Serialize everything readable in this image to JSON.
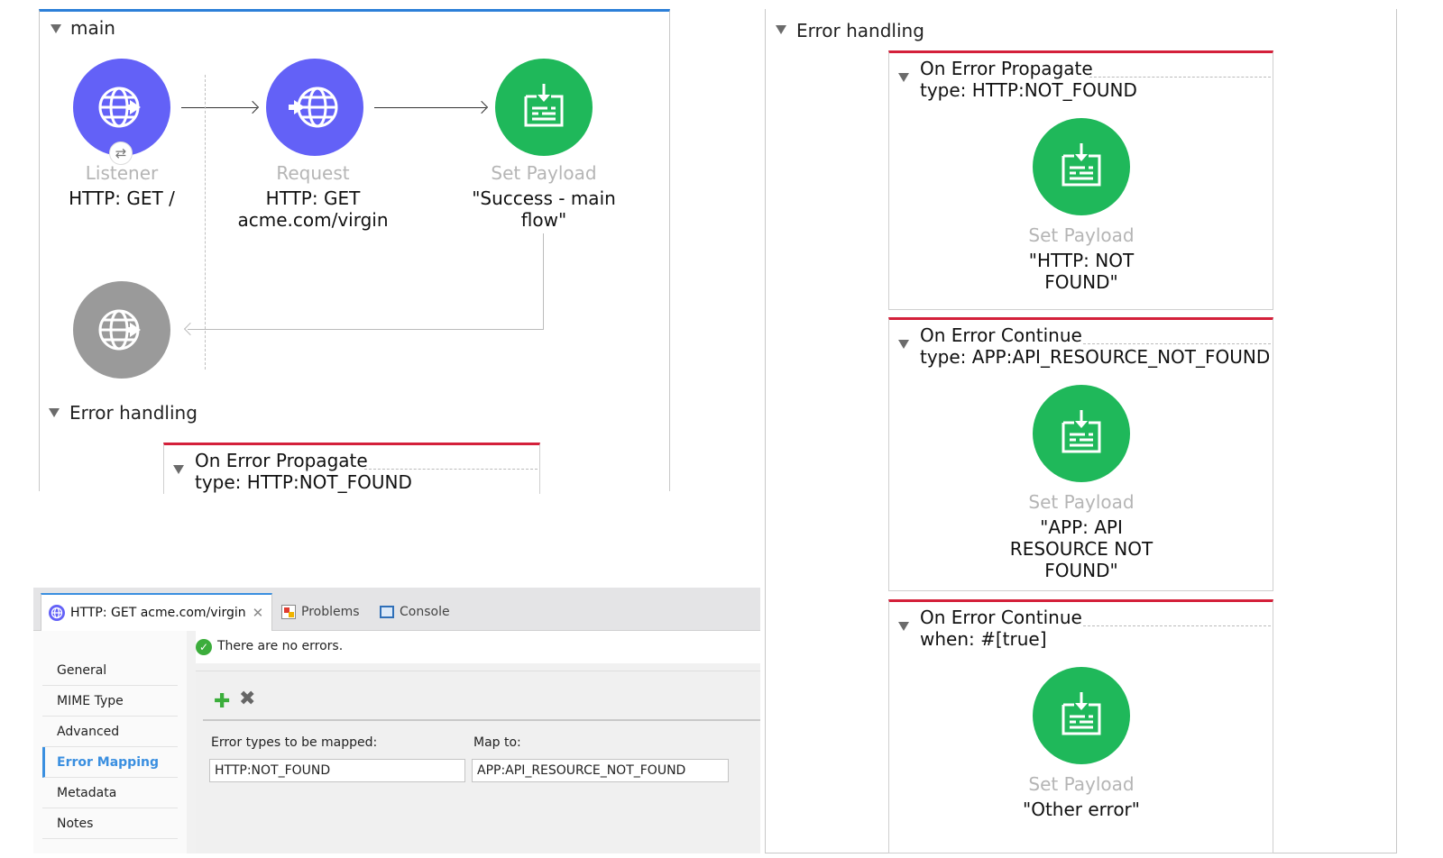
{
  "main_flow": {
    "title": "main",
    "nodes": [
      {
        "type": "Listener",
        "text": "HTTP: GET /"
      },
      {
        "type": "Request",
        "text": "HTTP: GET\nacme.com/virgin"
      },
      {
        "type": "Set Payload",
        "text": "\"Success - main\nflow\""
      }
    ],
    "error_handling": {
      "title": "Error handling",
      "handler": {
        "name": "On Error Propagate",
        "condition": "type: HTTP:NOT_FOUND"
      }
    }
  },
  "right_panel": {
    "title": "Error handling",
    "handlers": [
      {
        "name": "On Error Propagate",
        "condition": "type: HTTP:NOT_FOUND",
        "step_type": "Set Payload",
        "step_text": "\"HTTP: NOT\nFOUND\""
      },
      {
        "name": "On Error Continue",
        "condition": "type: APP:API_RESOURCE_NOT_FOUND",
        "step_type": "Set Payload",
        "step_text": "\"APP: API\nRESOURCE NOT\nFOUND\""
      },
      {
        "name": "On Error Continue",
        "condition": "when: #[true]",
        "step_type": "Set Payload",
        "step_text": "\"Other error\""
      }
    ]
  },
  "properties": {
    "tabs": {
      "active": "HTTP: GET acme.com/virgin",
      "problems": "Problems",
      "console": "Console"
    },
    "status": "There are no errors.",
    "sidebar": [
      "General",
      "MIME Type",
      "Advanced",
      "Error Mapping",
      "Metadata",
      "Notes"
    ],
    "active_sidebar": "Error Mapping",
    "mapping": {
      "col1_label": "Error types to be mapped:",
      "col2_label": "Map to:",
      "col1_value": "HTTP:NOT_FOUND",
      "col2_value": "APP:API_RESOURCE_NOT_FOUND"
    }
  },
  "colors": {
    "http_node": "#6361f7",
    "payload_node": "#1fb85a",
    "error_border": "#d4203a",
    "accent": "#3a8fe0"
  }
}
